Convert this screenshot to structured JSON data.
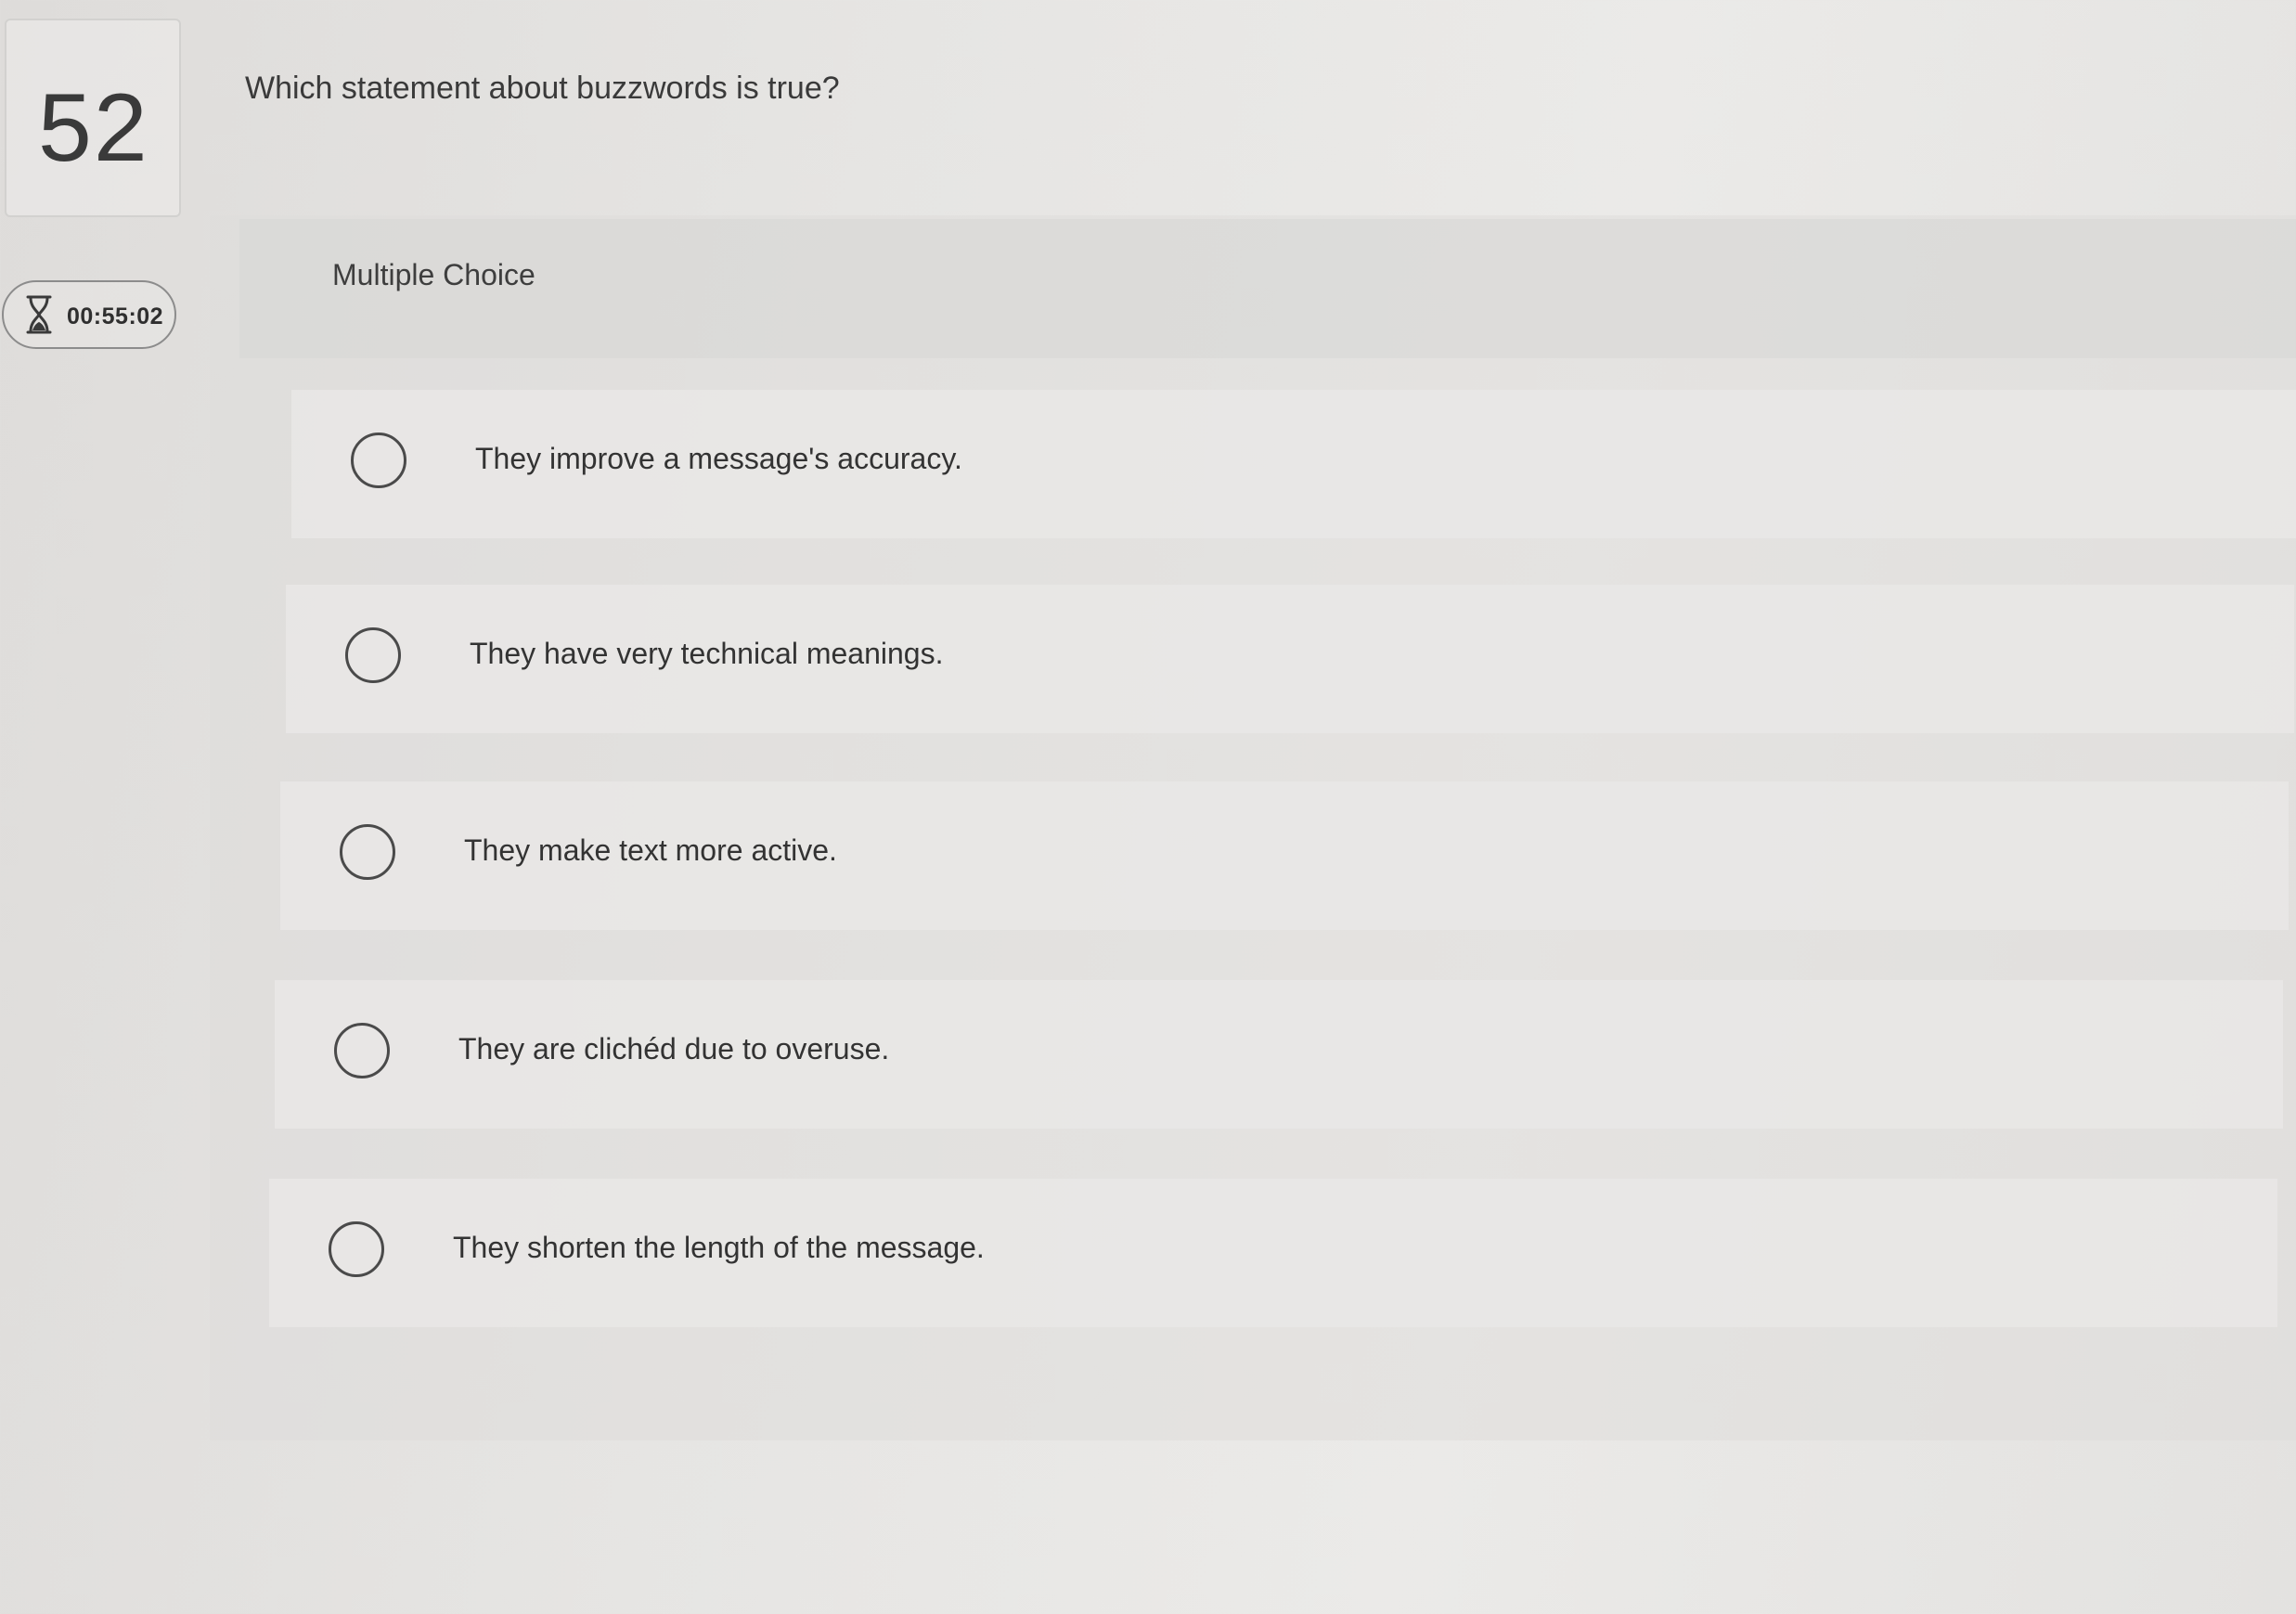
{
  "question": {
    "number": "52",
    "text": "Which statement about buzzwords is true?"
  },
  "timer": {
    "icon": "hourglass-icon",
    "value": "00:55:02"
  },
  "answer_panel": {
    "type_label": "Multiple Choice",
    "options": [
      {
        "label": "They improve a message's accuracy.",
        "selected": false
      },
      {
        "label": "They have very technical meanings.",
        "selected": false
      },
      {
        "label": "They make text more active.",
        "selected": false
      },
      {
        "label": "They are clichéd due to overuse.",
        "selected": false
      },
      {
        "label": "They shorten the length of the message.",
        "selected": false
      }
    ]
  }
}
